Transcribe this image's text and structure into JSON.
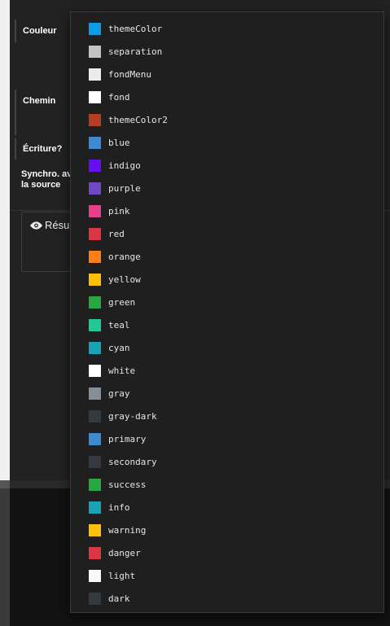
{
  "form": {
    "couleur_label": "Couleur",
    "chemin_label": "Chemin",
    "ecriture_label": "Écriture?",
    "synchro_label": "Synchro. av",
    "synchro_label_2": "la source",
    "resume_title": "Résum"
  },
  "dropdown": {
    "options": [
      {
        "label": "themeColor",
        "color": "#0d9be8"
      },
      {
        "label": "separation",
        "color": "#c4c4c4"
      },
      {
        "label": "fondMenu",
        "color": "#ececec"
      },
      {
        "label": "fond",
        "color": "#ffffff"
      },
      {
        "label": "themeColor2",
        "color": "#b63c22"
      },
      {
        "label": "blue",
        "color": "#3d89d2"
      },
      {
        "label": "indigo",
        "color": "#6610f2"
      },
      {
        "label": "purple",
        "color": "#7048c6"
      },
      {
        "label": "pink",
        "color": "#e83e8c"
      },
      {
        "label": "red",
        "color": "#dc3545"
      },
      {
        "label": "orange",
        "color": "#fd7e14"
      },
      {
        "label": "yellow",
        "color": "#ffc107"
      },
      {
        "label": "green",
        "color": "#28a745"
      },
      {
        "label": "teal",
        "color": "#20c997"
      },
      {
        "label": "cyan",
        "color": "#17a2b8"
      },
      {
        "label": "white",
        "color": "#ffffff"
      },
      {
        "label": "gray",
        "color": "#868e96"
      },
      {
        "label": "gray-dark",
        "color": "#343a40"
      },
      {
        "label": "primary",
        "color": "#3d89d2"
      },
      {
        "label": "secondary",
        "color": "#343a40"
      },
      {
        "label": "success",
        "color": "#28a745"
      },
      {
        "label": "info",
        "color": "#17a2b8"
      },
      {
        "label": "warning",
        "color": "#ffc107"
      },
      {
        "label": "danger",
        "color": "#dc3545"
      },
      {
        "label": "light",
        "color": "#f8f9fa"
      },
      {
        "label": "dark",
        "color": "#343a40"
      }
    ]
  }
}
